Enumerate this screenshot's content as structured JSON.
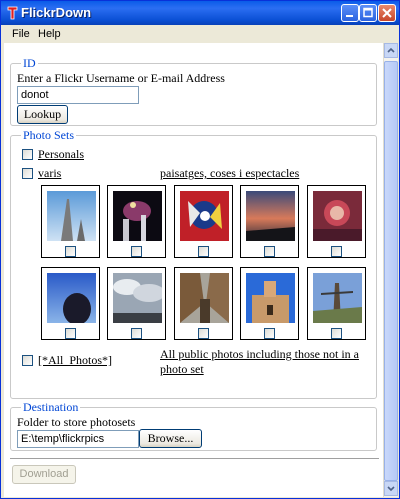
{
  "window": {
    "title": "FlickrDown"
  },
  "menu": [
    "File",
    "Help"
  ],
  "id_group": {
    "legend": "ID",
    "prompt": "Enter a Flickr Username or E-mail Address",
    "username_value": "donot",
    "lookup_label": "Lookup"
  },
  "photosets": {
    "legend": "Photo Sets",
    "sets": [
      {
        "name": "Personals",
        "checked": false
      },
      {
        "name": "varis",
        "checked": false,
        "description": "paisatges, coses i espectacles"
      }
    ],
    "all_photos": {
      "name": "[*All_Photos*]",
      "description_line1": "All public photos including those not in a",
      "description_line2": "photo set"
    }
  },
  "destination": {
    "legend": "Destination",
    "prompt": "Folder to store photosets",
    "folder_value": "E:\\temp\\flickrpics",
    "browse_label": "Browse..."
  },
  "download_label": "Download",
  "colors": {
    "legend_blue": "#0046d5",
    "title_bar": "#0a5ce8"
  }
}
